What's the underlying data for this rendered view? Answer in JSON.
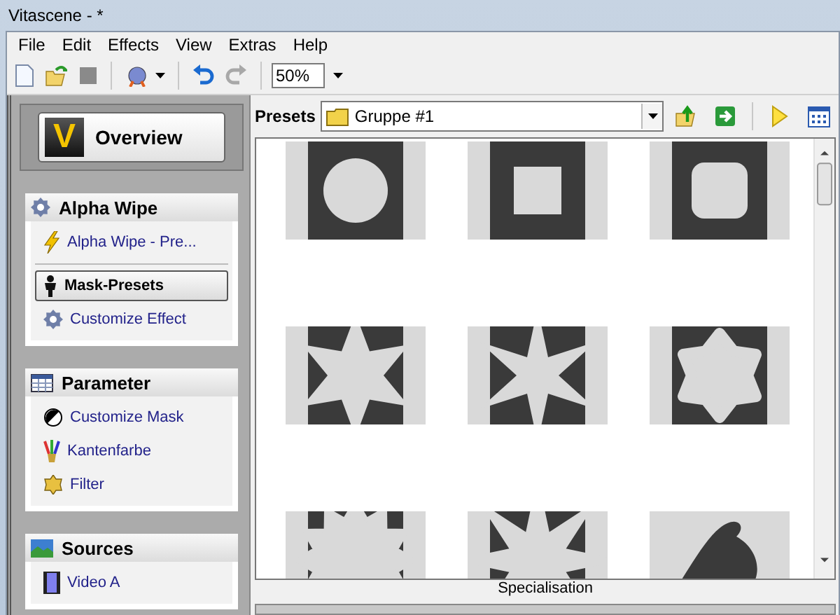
{
  "window": {
    "title": "Vitascene - *"
  },
  "menu": [
    "File",
    "Edit",
    "Effects",
    "View",
    "Extras",
    "Help"
  ],
  "toolbar": {
    "zoom": {
      "value": "50%"
    },
    "redo": {
      "disabled": true
    }
  },
  "overview": {
    "logo": "V",
    "label": "Overview"
  },
  "sections": [
    {
      "title": "Alpha Wipe",
      "items": [
        {
          "label": "Alpha Wipe - Pre...",
          "selected": false
        },
        {
          "label": "Mask-Presets",
          "selected": true
        },
        {
          "label": "Customize Effect",
          "selected": false
        }
      ]
    },
    {
      "title": "Parameter",
      "items": [
        {
          "label": "Customize Mask",
          "selected": false
        },
        {
          "label": "Kantenfarbe",
          "selected": false
        },
        {
          "label": "Filter",
          "selected": false
        }
      ]
    },
    {
      "title": "Sources",
      "items": [
        {
          "label": "Video A",
          "selected": false
        }
      ]
    }
  ],
  "presets": {
    "label": "Presets",
    "group": {
      "value": "Gruppe #1"
    },
    "items": [
      {
        "kind": "circle"
      },
      {
        "kind": "square"
      },
      {
        "kind": "rounded"
      },
      {
        "kind": "star"
      },
      {
        "kind": "sharpstar"
      },
      {
        "kind": "softstar"
      },
      {
        "kind": "gear"
      },
      {
        "kind": "burst"
      },
      {
        "kind": "swirl"
      }
    ]
  },
  "status": {
    "label": "Specialisation"
  }
}
